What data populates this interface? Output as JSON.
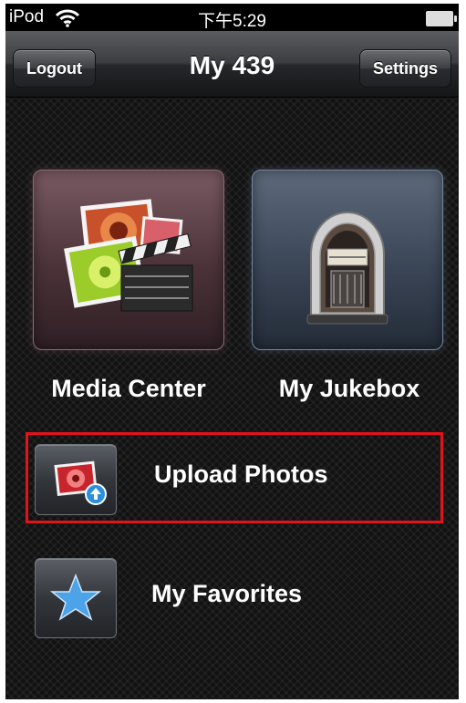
{
  "status_bar": {
    "carrier": "iPod",
    "time": "下午5:29",
    "icons": [
      "wifi-icon",
      "battery-icon"
    ]
  },
  "nav_bar": {
    "title": "My 439",
    "left_button": "Logout",
    "right_button": "Settings"
  },
  "tiles": [
    {
      "label": "Media Center",
      "icon": "media-center-icon"
    },
    {
      "label": "My Jukebox",
      "icon": "jukebox-icon"
    }
  ],
  "rows": [
    {
      "label": "Upload Photos",
      "icon": "upload-photo-icon",
      "highlighted": true
    },
    {
      "label": "My Favorites",
      "icon": "star-icon",
      "highlighted": false
    }
  ],
  "colors": {
    "highlight_border": "#e3121b",
    "background": "#121212",
    "star": "#4da3e8"
  }
}
